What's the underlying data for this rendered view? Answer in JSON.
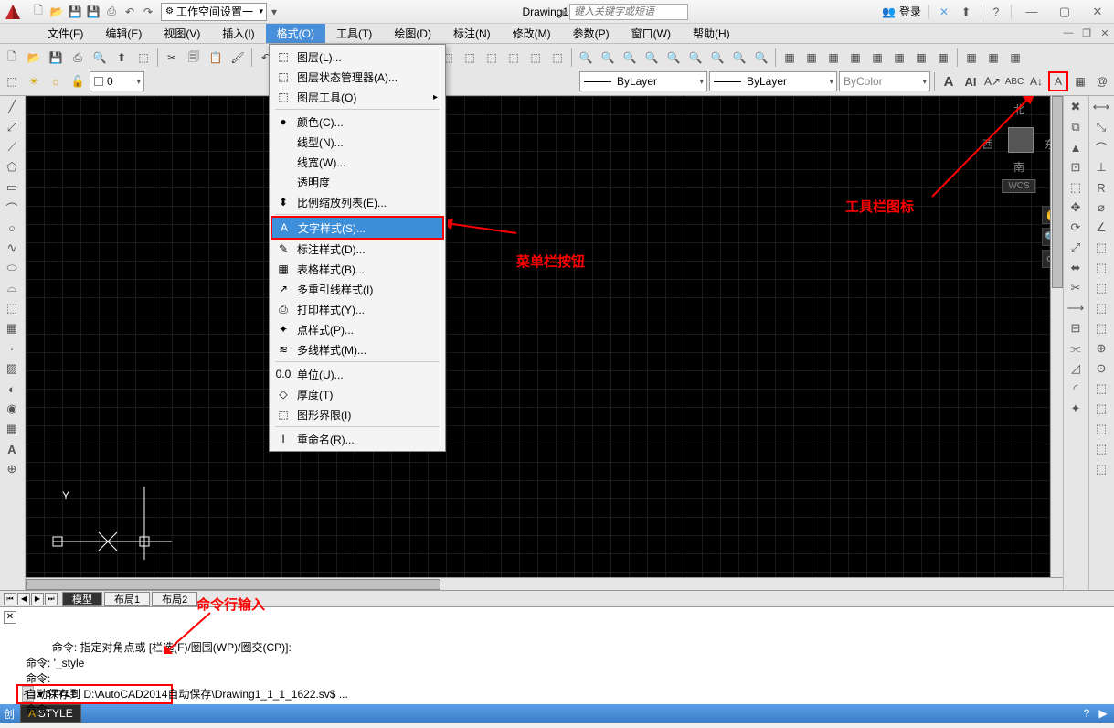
{
  "title": "Drawing1.dwg",
  "workspace": "工作空间设置一",
  "search_placeholder": "键入关键字或短语",
  "login_label": "登录",
  "menus": [
    "文件(F)",
    "编辑(E)",
    "视图(V)",
    "插入(I)",
    "格式(O)",
    "工具(T)",
    "绘图(D)",
    "标注(N)",
    "修改(M)",
    "参数(P)",
    "窗口(W)",
    "帮助(H)"
  ],
  "active_menu_index": 4,
  "dropdown": [
    {
      "icon": "⬚",
      "label": "图层(L)..."
    },
    {
      "icon": "⬚",
      "label": "图层状态管理器(A)..."
    },
    {
      "icon": "⬚",
      "label": "图层工具(O)",
      "sub": true
    },
    {
      "sep": true
    },
    {
      "icon": "●",
      "label": "颜色(C)..."
    },
    {
      "icon": "",
      "label": "线型(N)..."
    },
    {
      "icon": "",
      "label": "线宽(W)..."
    },
    {
      "icon": "",
      "label": "透明度"
    },
    {
      "icon": "⬍",
      "label": "比例缩放列表(E)..."
    },
    {
      "sep": true
    },
    {
      "icon": "A",
      "label": "文字样式(S)...",
      "selected": true,
      "highlight": true
    },
    {
      "icon": "✎",
      "label": "标注样式(D)..."
    },
    {
      "icon": "▦",
      "label": "表格样式(B)..."
    },
    {
      "icon": "↗",
      "label": "多重引线样式(I)"
    },
    {
      "icon": "⎙",
      "label": "打印样式(Y)..."
    },
    {
      "icon": "✦",
      "label": "点样式(P)..."
    },
    {
      "icon": "≋",
      "label": "多线样式(M)..."
    },
    {
      "sep": true
    },
    {
      "icon": "0.0",
      "label": "单位(U)..."
    },
    {
      "icon": "◇",
      "label": "厚度(T)"
    },
    {
      "icon": "⬚",
      "label": "图形界限(I)"
    },
    {
      "sep": true
    },
    {
      "icon": "I",
      "label": "重命名(R)..."
    }
  ],
  "layer_current": "0",
  "prop_linetype": "ByLayer",
  "prop_lineweight": "ByLayer",
  "prop_color": "ByColor",
  "viewcube": {
    "n": "北",
    "s": "南",
    "w": "西",
    "e": "东",
    "label": "WCS"
  },
  "tabs": [
    "模型",
    "布局1",
    "布局2"
  ],
  "active_tab": 0,
  "cmd_history": "命令: 指定对角点或 [栏选(F)/圈围(WP)/圈交(CP)]:\n命令: '_style\n命令:\n自动保存到 D:\\AutoCAD2014自动保存\\Drawing1_1_1_1622.sv$ ...\n命令:",
  "cmd_input": "STYLE",
  "status_text": "创",
  "status_dyn": "STYLE",
  "annotations": {
    "menu_btn": "菜单栏按钮",
    "toolbar_icon": "工具栏图标",
    "cmd_input_label": "命令行输入"
  }
}
